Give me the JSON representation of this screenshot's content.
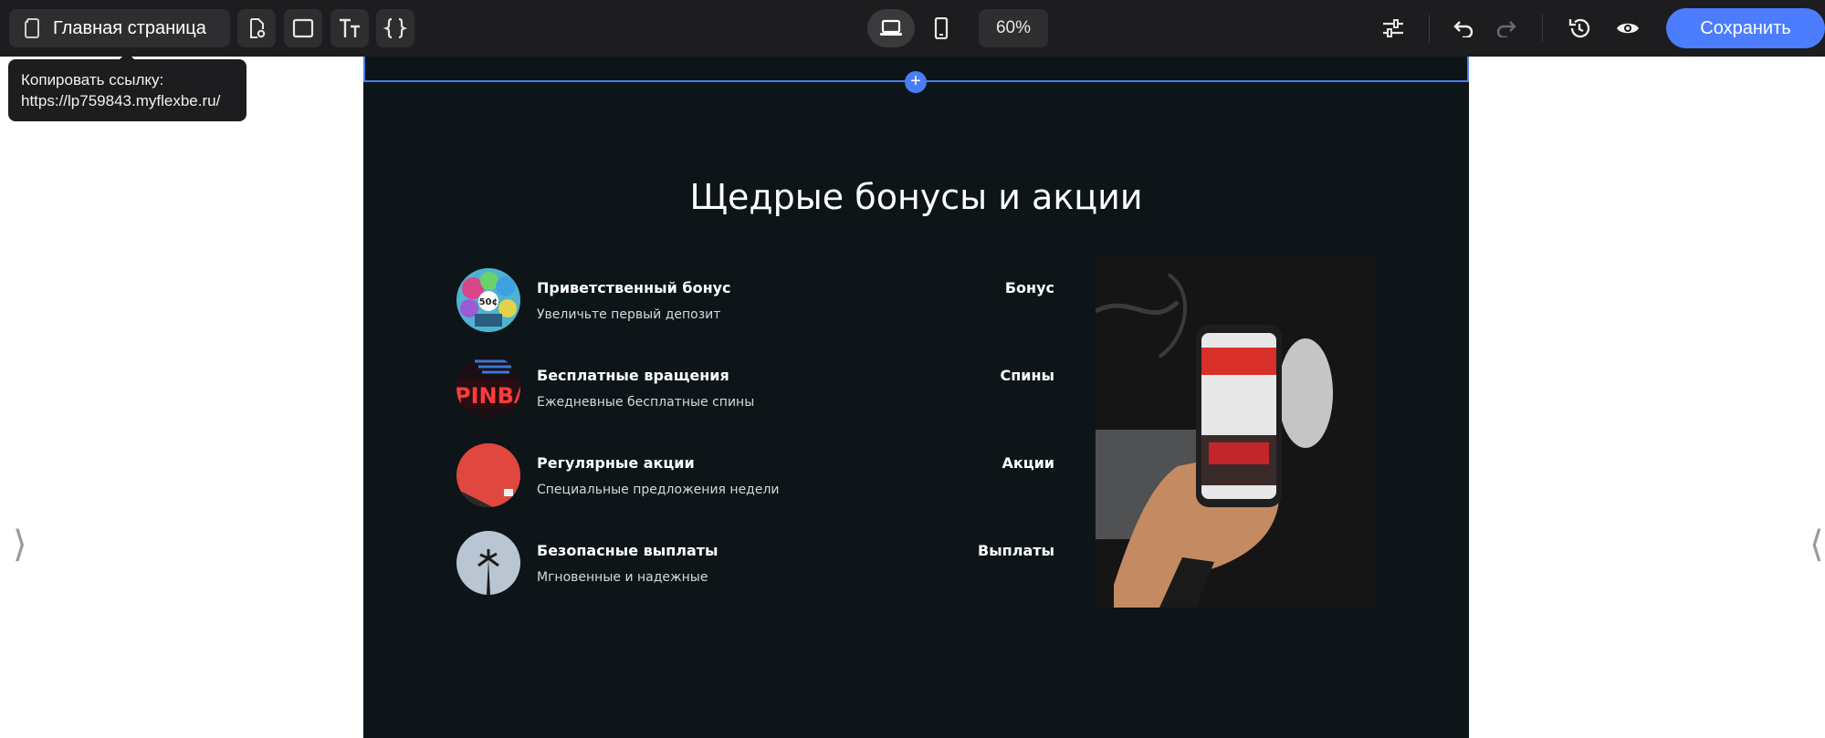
{
  "toolbar": {
    "page_label": "Главная страница",
    "zoom": "60%",
    "save_label": "Сохранить"
  },
  "tooltip": {
    "line1": "Копировать ссылку:",
    "line2": "https://lp759843.myflexbe.ru/"
  },
  "section": {
    "title": "Щедрые бонусы и акции",
    "items": [
      {
        "title": "Приветственный бонус",
        "desc": "Увеличьте первый депозит",
        "tag": "Бонус",
        "icon": "balloons-image"
      },
      {
        "title": "Бесплатные вращения",
        "desc": "Ежедневные бесплатные спины",
        "tag": "Спины",
        "icon": "pinball-sign-image"
      },
      {
        "title": "Регулярные акции",
        "desc": "Специальные предложения недели",
        "tag": "Акции",
        "icon": "red-card-image"
      },
      {
        "title": "Безопасные выплаты",
        "desc": "Мгновенные и надежные",
        "tag": "Выплаты",
        "icon": "palm-tree-image"
      }
    ]
  },
  "edge": {
    "left": "⟩",
    "right": "⟨"
  },
  "colors": {
    "toolbar_bg": "#1d1d1f",
    "accent": "#4c7dff",
    "section_bg": "#0d1519",
    "selection": "#4a7cf5"
  }
}
